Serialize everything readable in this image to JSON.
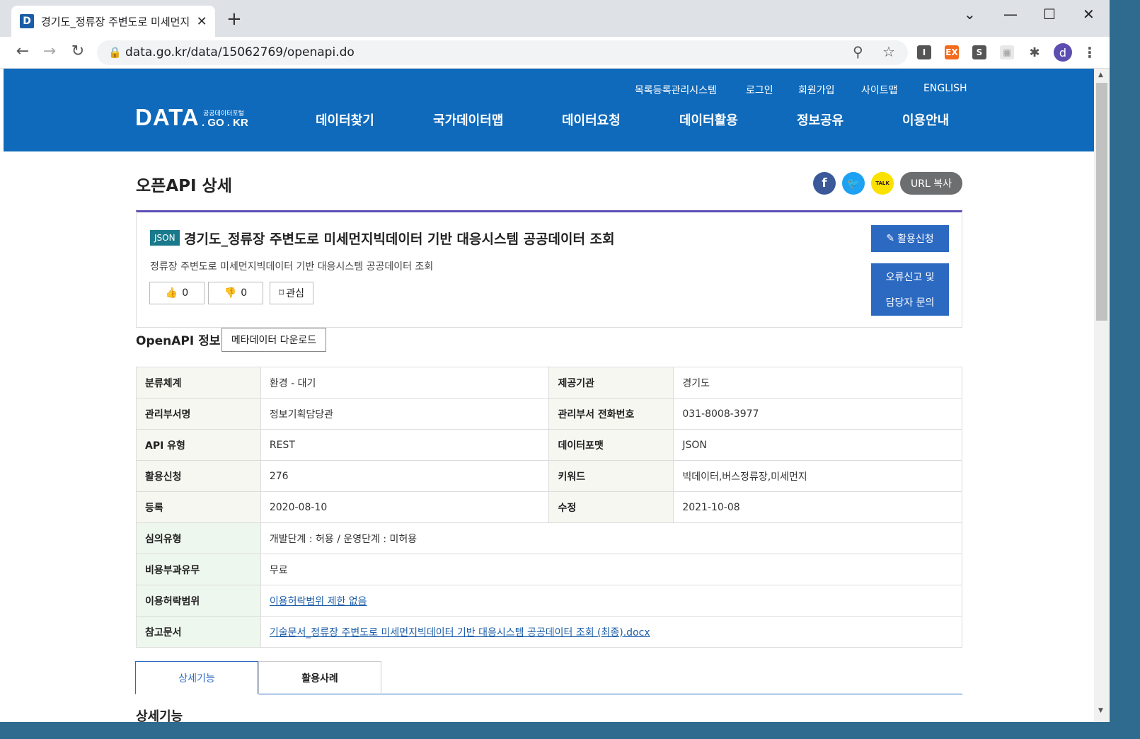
{
  "browser": {
    "tab_title": "경기도_정류장 주변도로 미세먼지",
    "url": "data.go.kr/data/15062769/openapi.do",
    "avatar_letter": "d"
  },
  "header": {
    "logo_main": "DATA",
    "logo_small": "공공데이터포털",
    "logo_domain": ". GO . KR",
    "util_links": [
      "목록등록관리시스템",
      "로그인",
      "회원가입",
      "사이트맵",
      "ENGLISH"
    ],
    "nav": [
      "데이터찾기",
      "국가데이터맵",
      "데이터요청",
      "데이터활용",
      "정보공유",
      "이용안내"
    ]
  },
  "page": {
    "title": "오픈API 상세",
    "url_copy": "URL 복사",
    "talk": "TALK"
  },
  "card": {
    "badge": "JSON",
    "title": "경기도_정류장 주변도로 미세먼지빅데이터 기반 대응시스템 공공데이터 조회",
    "desc": "정류장 주변도로 미세먼지빅데이터 기반 대응시스템 공공데이터 조회",
    "like_count": "0",
    "dislike_count": "0",
    "bookmark_label": "관심",
    "apply_label": "활용신청",
    "report_line1": "오류신고 및",
    "report_line2": "담당자 문의"
  },
  "openapi": {
    "section_title": "OpenAPI 정보",
    "meta_download": "메타데이터 다운로드"
  },
  "info": {
    "r1": {
      "k1": "분류체계",
      "v1": "환경 - 대기",
      "k2": "제공기관",
      "v2": "경기도"
    },
    "r2": {
      "k1": "관리부서명",
      "v1": "정보기획담당관",
      "k2": "관리부서 전화번호",
      "v2": "031-8008-3977"
    },
    "r3": {
      "k1": "API 유형",
      "v1": "REST",
      "k2": "데이터포맷",
      "v2": "JSON"
    },
    "r4": {
      "k1": "활용신청",
      "v1": "276",
      "k2": "키워드",
      "v2": "빅데이터,버스정류장,미세먼지"
    },
    "r5": {
      "k1": "등록",
      "v1": "2020-08-10",
      "k2": "수정",
      "v2": "2021-10-08"
    },
    "r6": {
      "k1": "심의유형",
      "v1": "개발단계 : 허용 / 운영단계 : 미허용"
    },
    "r7": {
      "k1": "비용부과유무",
      "v1": "무료"
    },
    "r8": {
      "k1": "이용허락범위",
      "v1": "이용허락범위 제한 없음"
    },
    "r9": {
      "k1": "참고문서",
      "v1": "기술문서_정류장 주변도로 미세먼지빅데이터 기반 대응시스템 공공데이터 조회 (최종).docx"
    }
  },
  "bottom_tabs": [
    "상세기능",
    "활용사례"
  ],
  "sub_title": "상세기능",
  "colors": {
    "header_blue": "#0f6abb",
    "button_blue": "#2c6ac2",
    "card_accent": "#5a4fb5"
  }
}
